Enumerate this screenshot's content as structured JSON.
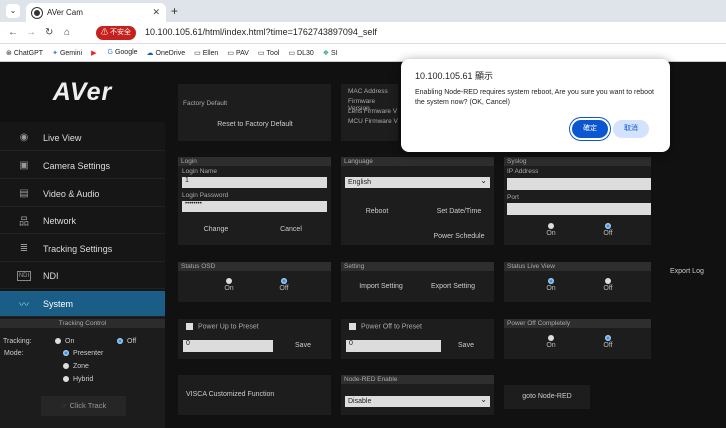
{
  "browser": {
    "tab_title": "AVer Cam",
    "insecure_label": "不安全",
    "url": "10.100.105.61/html/index.html?time=1762743897094_self",
    "bookmarks": [
      "ChatGPT",
      "Gemini",
      "",
      "Google",
      "OneDrive",
      "Ellen",
      "PAV",
      "Tool",
      "DL30",
      "SI"
    ]
  },
  "logo": "AVer",
  "sidebar": {
    "items": [
      {
        "label": "Live View",
        "icon": "eye-icon"
      },
      {
        "label": "Camera Settings",
        "icon": "image-icon"
      },
      {
        "label": "Video & Audio",
        "icon": "video-audio-icon"
      },
      {
        "label": "Network",
        "icon": "network-icon"
      },
      {
        "label": "Tracking Settings",
        "icon": "tracking-icon"
      },
      {
        "label": "NDI",
        "icon": "ndi-icon"
      },
      {
        "label": "System",
        "icon": "pulse-icon"
      }
    ],
    "active": "System"
  },
  "tracking_control": {
    "header": "Tracking Control",
    "tracking_label": "Tracking:",
    "mode_label": "Mode:",
    "on": "On",
    "off": "Off",
    "modes": [
      "Presenter",
      "Zone",
      "Hybrid"
    ],
    "click_track": "Click Track"
  },
  "factory": {
    "header": "Factory Default",
    "button": "Reset to Factory Default"
  },
  "device_info": {
    "labels": [
      "MAC Address",
      "Firmware Version",
      "Lens Firmware V",
      "MCU Firmware V"
    ]
  },
  "login": {
    "header": "Login",
    "name_label": "Login Name",
    "name_value": "1",
    "password_label": "Login Password",
    "password_value": "••••••••",
    "change": "Change",
    "cancel": "Cancel"
  },
  "language": {
    "header": "Language",
    "value": "English",
    "reboot": "Reboot",
    "set_date": "Set Date/Time",
    "power_schedule": "Power Schedule"
  },
  "syslog": {
    "header": "Syslog",
    "ip_label": "IP Address",
    "port_label": "Port",
    "on": "On",
    "off": "Off"
  },
  "status_osd": {
    "header": "Status OSD",
    "on": "On",
    "off": "Off"
  },
  "setting": {
    "header": "Setting",
    "import": "Import Setting",
    "export": "Export Setting"
  },
  "status_live": {
    "header": "Status Live View",
    "on": "On",
    "off": "Off"
  },
  "export_log": "Export Log",
  "power_up": {
    "label": "Power Up to Preset",
    "value": "0",
    "save": "Save"
  },
  "power_off": {
    "label": "Power Off to Preset",
    "value": "0",
    "save": "Save"
  },
  "power_off_completely": {
    "header": "Power Off Completely",
    "on": "On",
    "off": "Off"
  },
  "visca": "VISCA Customized Function",
  "node_red": {
    "header": "Node-RED Enable",
    "value": "Disable",
    "goto": "goto Node-RED"
  },
  "dialog": {
    "title": "10.100.105.61 顯示",
    "message": "Enabling Node-RED requires system reboot, Are you sure you want to reboot the system now? (OK, Cancel)",
    "ok": "確定",
    "cancel": "取消"
  },
  "colors": {
    "accent": "#1a5d87",
    "dialog_primary": "#0b57d0"
  }
}
